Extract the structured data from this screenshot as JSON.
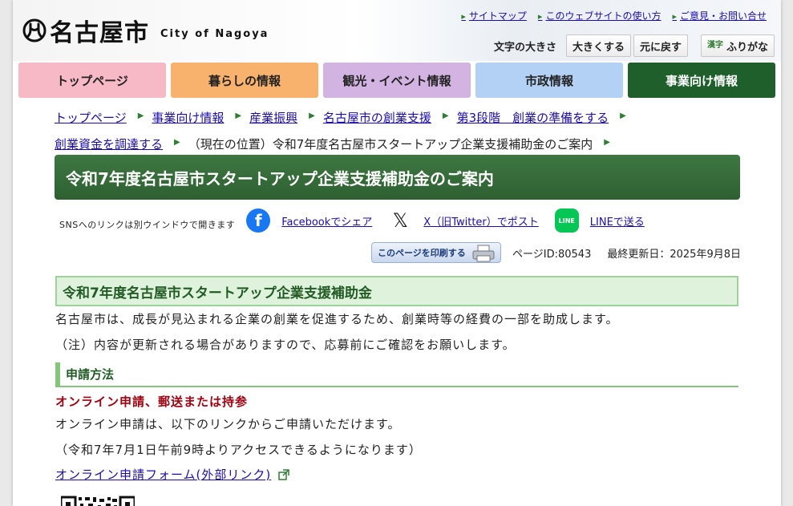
{
  "header": {
    "logo_text": "名古屋市",
    "logo_sub": "City of Nagoya",
    "util_links": [
      "サイトマップ",
      "このウェブサイトの使い方",
      "ご意見・お問い合せ"
    ],
    "font_size_label": "文字の大きさ",
    "font_bigger": "大きくする",
    "font_reset": "元に戻す",
    "furigana": "ふりがな",
    "furigana_icon_text": "漢字"
  },
  "gnav": {
    "items": [
      "トップページ",
      "暮らしの情報",
      "観光・イベント情報",
      "市政情報",
      "事業向け情報"
    ]
  },
  "breadcrumb": {
    "items": [
      "トップページ",
      "事業向け情報",
      "産業振興",
      "名古屋市の創業支援",
      "第3段階　創業の準備をする",
      "創業資金を調達する"
    ],
    "current": "（現在の位置）令和7年度名古屋市スタートアップ企業支援補助金のご案内"
  },
  "page": {
    "title": "令和7年度名古屋市スタートアップ企業支援補助金のご案内",
    "sns_note": "SNSへのリンクは別ウインドウで開きます",
    "sns_facebook": "Facebookでシェア",
    "sns_x": "X（旧Twitter）でポスト",
    "sns_line": "LINEで送る",
    "print_label": "このページを印刷する",
    "page_id": "ページID:80543",
    "last_updated": "最終更新日：2025年9月8日"
  },
  "content": {
    "h2": "令和7年度名古屋市スタートアップ企業支援補助金",
    "intro": "名古屋市は、成長が見込まれる企業の創業を促進するため、創業時等の経費の一部を助成します。",
    "note": "（注）内容が更新される場合がありますので、応募前にご確認をお願いします。",
    "h3": "申請方法",
    "h4": "オンライン申請、郵送または持参",
    "online_text": "オンライン申請は、以下のリンクからご申請いただけます。",
    "access_note": "（令和7年7月1日午前9時よりアクセスできるようになります）",
    "form_link": "オンライン申請フォーム(外部リンク)"
  },
  "colors": {
    "nav_top": "#f8b9c6",
    "nav_living": "#f9b26d",
    "nav_tourism": "#d3b3e2",
    "nav_city": "#b3d1f4",
    "nav_business": "#1f5f2b",
    "title_bar": "#3e7741",
    "alert_red": "#a0000f"
  }
}
